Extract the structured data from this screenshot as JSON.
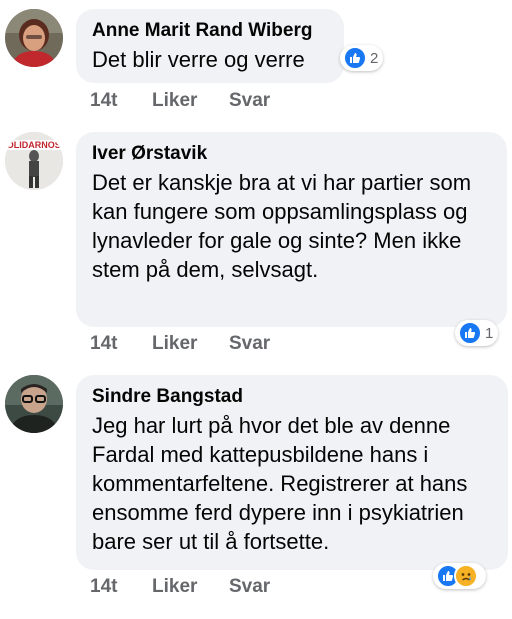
{
  "comments": [
    {
      "author": "Anne Marit Rand Wiberg",
      "text": "Det blir verre og verre",
      "time": "14t",
      "like_label": "Liker",
      "reply_label": "Svar",
      "reaction_count": "2",
      "reactions": [
        "like-icon"
      ]
    },
    {
      "author": "Iver Ørstavik",
      "text": "Det er kanskje bra at vi har partier som kan fungere som oppsamlingsplass og lynavleder for gale og sinte? Men ikke stem på dem, selvsagt.",
      "time": "14t",
      "like_label": "Liker",
      "reply_label": "Svar",
      "reaction_count": "1",
      "reactions": [
        "like-icon"
      ]
    },
    {
      "author": "Sindre Bangstad",
      "text": "Jeg har lurt på hvor det ble av denne Fardal med kattepusbildene hans i kommentarfeltene. Registrerer at hans ensomme ferd dypere inn i psykiatrien bare ser ut til å fortsette.",
      "time": "14t",
      "like_label": "Liker",
      "reply_label": "Svar",
      "reaction_count": "",
      "reactions": [
        "like-icon",
        "sad-face-icon"
      ]
    }
  ],
  "colors": {
    "bubble": "#f0f2f5",
    "meta_text": "#65676b",
    "like_blue": "#1877f2",
    "sad_yellow": "#f7b125"
  }
}
